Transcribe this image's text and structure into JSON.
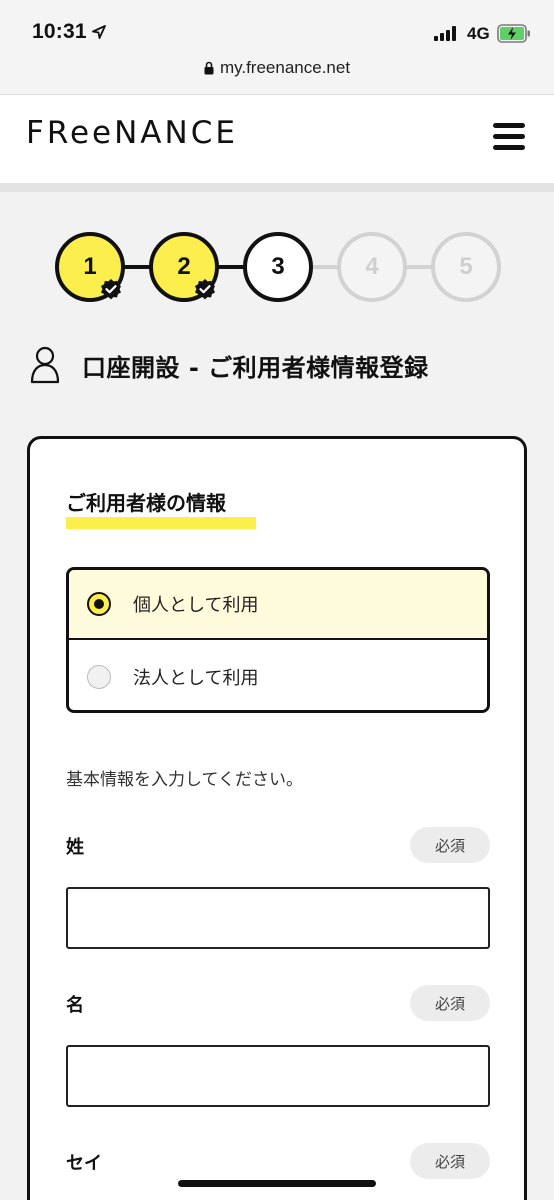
{
  "status_bar": {
    "time": "10:31",
    "network": "4G",
    "url": "my.freenance.net"
  },
  "header": {
    "logo": "FReeNANCE",
    "menu_icon": "hamburger-icon"
  },
  "stepper": {
    "steps": [
      {
        "number": "1",
        "state": "done"
      },
      {
        "number": "2",
        "state": "done"
      },
      {
        "number": "3",
        "state": "current"
      },
      {
        "number": "4",
        "state": "todo"
      },
      {
        "number": "5",
        "state": "todo"
      }
    ]
  },
  "page": {
    "title": "口座開設 - ご利用者様情報登録",
    "title_icon": "person-icon"
  },
  "form": {
    "section_title": "ご利用者様の情報",
    "usage_options": [
      {
        "label": "個人として利用",
        "selected": true
      },
      {
        "label": "法人として利用",
        "selected": false
      }
    ],
    "intro": "基本情報を入力してください。",
    "fields": [
      {
        "label": "姓",
        "badge": "必須",
        "value": ""
      },
      {
        "label": "名",
        "badge": "必須",
        "value": ""
      },
      {
        "label": "セイ",
        "badge": "必須",
        "value": ""
      }
    ]
  },
  "colors": {
    "accent_yellow": "#fbee4d",
    "selected_bg": "#fefbdc",
    "border_dark": "#111111",
    "inactive_gray": "#d2d2d2"
  }
}
